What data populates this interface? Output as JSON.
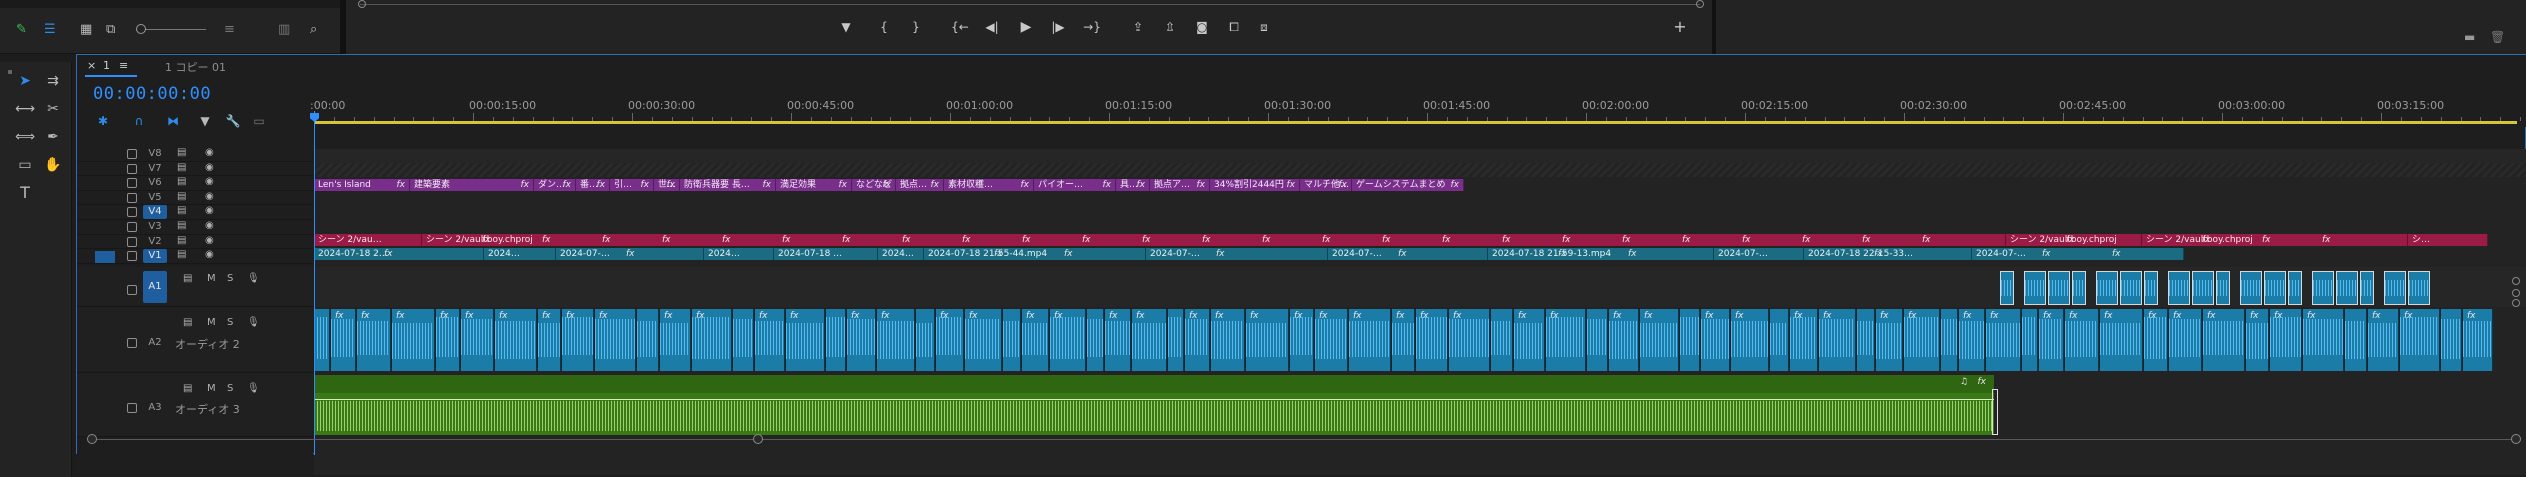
{
  "tabs": {
    "close": "×",
    "sequence_index": "1",
    "menu": "≡",
    "sequence_name": "1 コピー 01"
  },
  "timecode": "00:00:00:00",
  "ruler_ticks": [
    ":00:00",
    "00:00:15:00",
    "00:00:30:00",
    "00:00:45:00",
    "00:01:00:00",
    "00:01:15:00",
    "00:01:30:00",
    "00:01:45:00",
    "00:02:00:00",
    "00:02:15:00",
    "00:02:30:00",
    "00:02:45:00",
    "00:03:00:00",
    "00:03:15:00"
  ],
  "video_tracks": [
    "V8",
    "V7",
    "V6",
    "V5",
    "V4",
    "V3",
    "V2",
    "V1"
  ],
  "audio_tracks": [
    {
      "label": "A1",
      "name": ""
    },
    {
      "label": "A2",
      "name": "オーディオ 2"
    },
    {
      "label": "A3",
      "name": "オーディオ 3"
    }
  ],
  "track_buttons": {
    "mute": "M",
    "solo": "S"
  },
  "v6_clips": [
    "Len's Island",
    "建築要素",
    "ダン…",
    "番…",
    "引…",
    "世…",
    "防衛兵器要 長…",
    "満足効果",
    "などなど",
    "拠点…",
    "素材収穫…",
    "パイオー…",
    "具…",
    "拠点ア…",
    "34%割引2444円",
    "マルチ他…",
    "ゲームシステムまとめ"
  ],
  "v2_clips": [
    "シーン 2/vau…",
    "シーン 2/vaultboy.chproj",
    "シーン 2/vaultboy.chproj",
    "シーン 2/vaultboy.chproj",
    "シ…"
  ],
  "v1_clips": [
    "2024-07-18 2…",
    "2024…",
    "2024-07-…",
    "2024…",
    "2024-07-18 …",
    "2024…",
    "2024-07-18 21-55-44.mp4",
    "2024-07-…",
    "2024-07-…",
    "2024-07-18 21-59-13.mp4",
    "2024-07-…",
    "2024-07-18 22-15-33…",
    "2024-07-…"
  ],
  "fx_label": "fx",
  "audio_clip_label": "fx",
  "colors": {
    "accent_blue": "#2f8fff",
    "clip_purple": "#7a2e8c",
    "clip_crimson": "#9a1b45",
    "clip_teal": "#1b6b82",
    "audio_blue": "#1c7ca8",
    "audio_green": "#3a7a16",
    "work_area": "#d6c53b"
  },
  "icons": {
    "select": "selection-tool-icon",
    "track_select": "track-select-icon",
    "ripple": "ripple-edit-icon",
    "razor": "razor-icon",
    "slip": "slip-icon",
    "pen": "pen-icon",
    "rect": "rectangle-icon",
    "hand": "hand-icon",
    "type": "type-icon"
  },
  "transport_glyphs": {
    "marker": "▼",
    "in": "{",
    "out": "}",
    "go_in": "{←",
    "step_back": "◀|",
    "play": "▶",
    "step_fwd": "|▶",
    "go_out": "→}",
    "add": "+"
  }
}
